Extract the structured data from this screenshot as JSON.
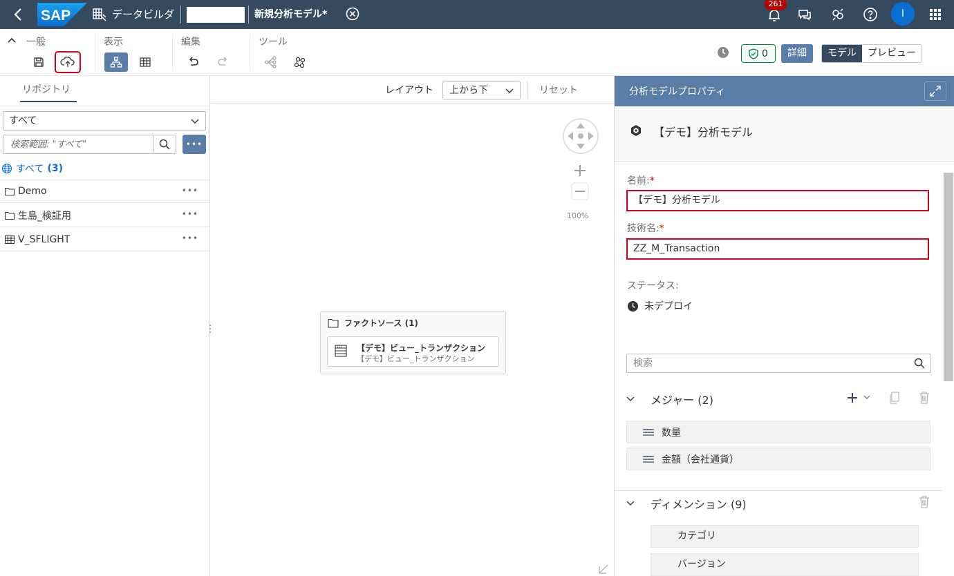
{
  "shell": {
    "logo_text": "SAP",
    "app_title": "データビルダ",
    "model_title": "新規分析モデル*",
    "notification_count": "261",
    "avatar_initial": "I",
    "brand_color": "#354a5f"
  },
  "toolbar": {
    "group_general": "一般",
    "group_view": "表示",
    "group_edit": "編集",
    "group_tools": "ツール",
    "validation_count": "0",
    "detail_label": "詳細",
    "mode_model": "モデル",
    "mode_preview": "プレビュー"
  },
  "repository": {
    "tab_label": "リポジトリ",
    "filter_value": "すべて",
    "search_placeholder": "検索範囲: \"すべて\"",
    "all_label": "すべて",
    "all_count": "(3)",
    "items": [
      {
        "label": "Demo",
        "icon": "folder-icon"
      },
      {
        "label": "生島_検証用",
        "icon": "folder-icon"
      },
      {
        "label": "V_SFLIGHT",
        "icon": "table-icon"
      }
    ]
  },
  "canvas": {
    "layout_label": "レイアウト",
    "layout_value": "上から下",
    "reset_label": "リセット",
    "zoom_level": "100%",
    "node": {
      "header": "ファクトソース (1)",
      "item_title": "【デモ】ビュー_トランザクション",
      "item_subtitle": "【デモ】ビュー_トランザクション"
    }
  },
  "properties": {
    "panel_title": "分析モデルプロパティ",
    "model_name": "【デモ】分析モデル",
    "name_label": "名前:",
    "name_value": "【デモ】分析モデル",
    "tech_name_label": "技術名:",
    "tech_name_value": "ZZ_M_Transaction",
    "status_label": "ステータス:",
    "status_value": "未デプロイ",
    "search_placeholder": "検索",
    "measures_title": "メジャー (2)",
    "measures": [
      "数量",
      "金額（会社通貨）"
    ],
    "dimensions_title": "ディメンション (9)",
    "dimensions": [
      "カテゴリ",
      "バージョン"
    ]
  }
}
